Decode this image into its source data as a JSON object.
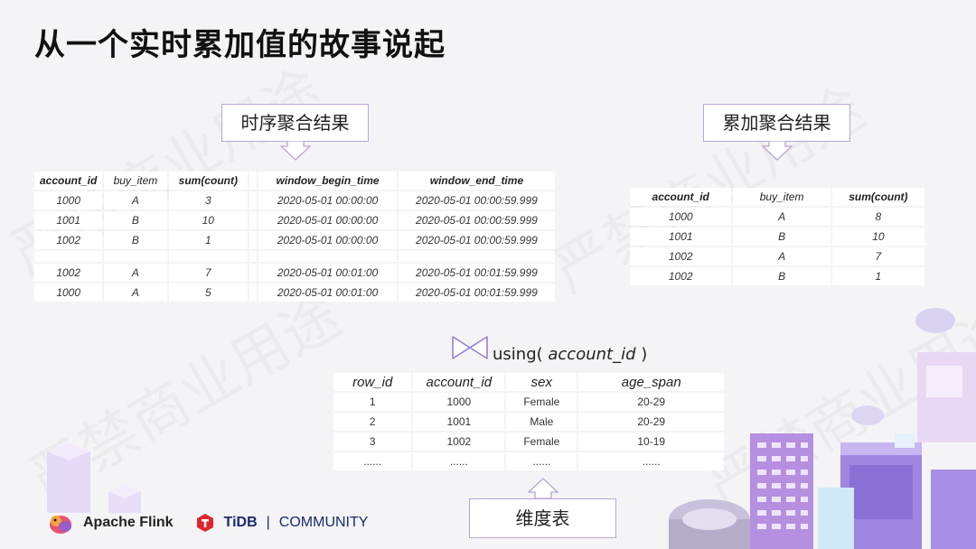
{
  "title": "从一个实时累加值的故事说起",
  "watermark_text": "严禁商业用途",
  "callouts": {
    "window_result": "时序聚合结果",
    "cumulative_result": "累加聚合结果",
    "dimension_table": "维度表"
  },
  "using": {
    "prefix": "using(",
    "key": " account_id",
    "suffix": " )"
  },
  "table_window": {
    "headers": [
      "account_id",
      "buy_item",
      "sum(count)",
      "",
      "window_begin_time",
      "window_end_time"
    ],
    "rows": [
      [
        "1000",
        "A",
        "3",
        "",
        "2020-05-01 00:00:00",
        "2020-05-01 00:00:59.999"
      ],
      [
        "1001",
        "B",
        "10",
        "",
        "2020-05-01 00:00:00",
        "2020-05-01 00:00:59.999"
      ],
      [
        "1002",
        "B",
        "1",
        "",
        "2020-05-01 00:00:00",
        "2020-05-01 00:00:59.999"
      ],
      [
        "",
        "",
        "",
        "",
        "",
        ""
      ],
      [
        "1002",
        "A",
        "7",
        "",
        "2020-05-01 00:01:00",
        "2020-05-01 00:01:59.999"
      ],
      [
        "1000",
        "A",
        "5",
        "",
        "2020-05-01 00:01:00",
        "2020-05-01 00:01:59.999"
      ]
    ]
  },
  "table_cumulative": {
    "headers": [
      "account_id",
      "buy_item",
      "sum(count)"
    ],
    "rows": [
      [
        "1000",
        "A",
        "8"
      ],
      [
        "1001",
        "B",
        "10"
      ],
      [
        "1002",
        "A",
        "7"
      ],
      [
        "1002",
        "B",
        "1"
      ]
    ]
  },
  "table_dimension": {
    "headers": [
      "row_id",
      "account_id",
      "sex",
      "age_span"
    ],
    "rows": [
      [
        "1",
        "1000",
        "Female",
        "20-29"
      ],
      [
        "2",
        "1001",
        "Male",
        "20-29"
      ],
      [
        "3",
        "1002",
        "Female",
        "10-19"
      ],
      [
        "......",
        "......",
        "......",
        "......"
      ]
    ]
  },
  "footer": {
    "flink": "Apache Flink",
    "tidb": "TiDB",
    "community": "COMMUNITY"
  },
  "colors": {
    "callout_border": "#b9a4d8",
    "accent_purple": "#9b7fd4",
    "tidb_red": "#e0262c",
    "tidb_navy": "#1a2a6c"
  }
}
